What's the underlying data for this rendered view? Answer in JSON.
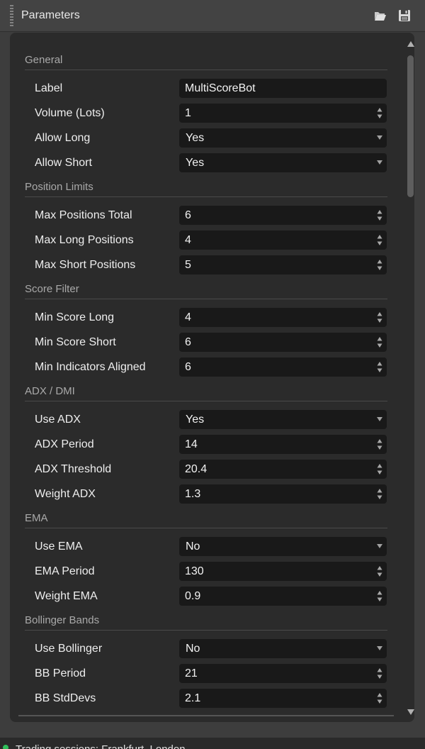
{
  "panel": {
    "title": "Parameters",
    "icons": {
      "open": "folder-open-icon",
      "save": "save-icon"
    }
  },
  "sections": [
    {
      "title": "General",
      "params": [
        {
          "label": "Label",
          "value": "MultiScoreBot",
          "kind": "text"
        },
        {
          "label": "Volume (Lots)",
          "value": "1",
          "kind": "number"
        },
        {
          "label": "Allow Long",
          "value": "Yes",
          "kind": "select"
        },
        {
          "label": "Allow Short",
          "value": "Yes",
          "kind": "select"
        }
      ]
    },
    {
      "title": "Position Limits",
      "params": [
        {
          "label": "Max Positions Total",
          "value": "6",
          "kind": "number"
        },
        {
          "label": "Max Long Positions",
          "value": "4",
          "kind": "number"
        },
        {
          "label": "Max Short Positions",
          "value": "5",
          "kind": "number"
        }
      ]
    },
    {
      "title": "Score Filter",
      "params": [
        {
          "label": "Min Score Long",
          "value": "4",
          "kind": "number"
        },
        {
          "label": "Min Score Short",
          "value": "6",
          "kind": "number"
        },
        {
          "label": "Min Indicators Aligned",
          "value": "6",
          "kind": "number"
        }
      ]
    },
    {
      "title": "ADX / DMI",
      "params": [
        {
          "label": "Use ADX",
          "value": "Yes",
          "kind": "select"
        },
        {
          "label": "ADX Period",
          "value": "14",
          "kind": "number"
        },
        {
          "label": "ADX Threshold",
          "value": "20.4",
          "kind": "number"
        },
        {
          "label": "Weight ADX",
          "value": "1.3",
          "kind": "number"
        }
      ]
    },
    {
      "title": "EMA",
      "params": [
        {
          "label": "Use EMA",
          "value": "No",
          "kind": "select"
        },
        {
          "label": "EMA Period",
          "value": "130",
          "kind": "number"
        },
        {
          "label": "Weight EMA",
          "value": "0.9",
          "kind": "number"
        }
      ]
    },
    {
      "title": "Bollinger Bands",
      "params": [
        {
          "label": "Use Bollinger",
          "value": "No",
          "kind": "select"
        },
        {
          "label": "BB Period",
          "value": "21",
          "kind": "number"
        },
        {
          "label": "BB StdDevs",
          "value": "2.1",
          "kind": "number"
        }
      ]
    }
  ],
  "footer": {
    "text": "Trading sessions: Frankfurt, London"
  },
  "colors": {
    "accent_green": "#2fbf5a",
    "field_bg": "#191919",
    "panel_bg": "#2b2b2b"
  }
}
